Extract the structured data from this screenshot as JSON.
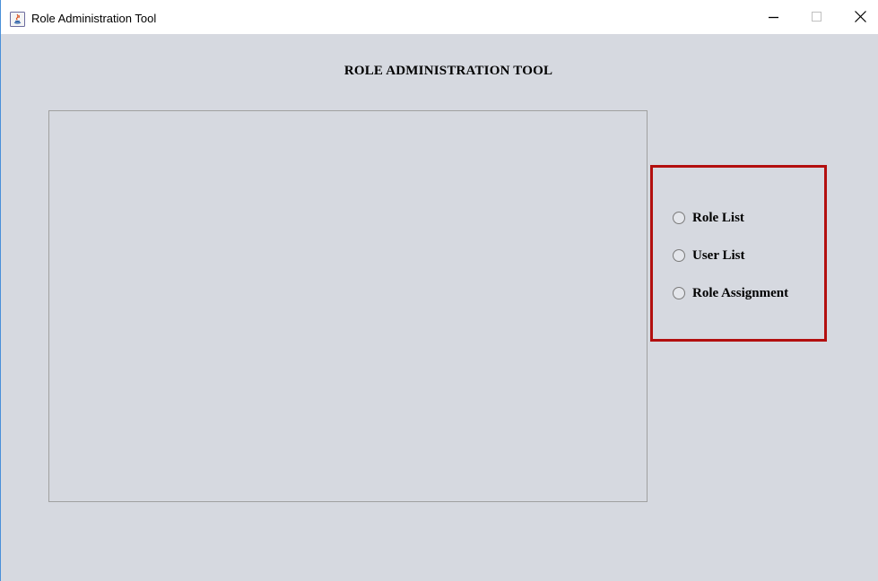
{
  "window": {
    "title": "Role Administration Tool",
    "border_color": "#4a90d9",
    "background": "#d6d9e0"
  },
  "title_bar_buttons": {
    "minimize_icon": "minimize-icon",
    "maximize_icon": "maximize-icon",
    "close_icon": "close-icon"
  },
  "main": {
    "heading": "ROLE ADMINISTRATION TOOL"
  },
  "radio_group": {
    "highlight_color": "#b30f0f",
    "options": [
      {
        "label": "Role List",
        "selected": false
      },
      {
        "label": "User List",
        "selected": false
      },
      {
        "label": "Role Assignment",
        "selected": false
      }
    ]
  }
}
